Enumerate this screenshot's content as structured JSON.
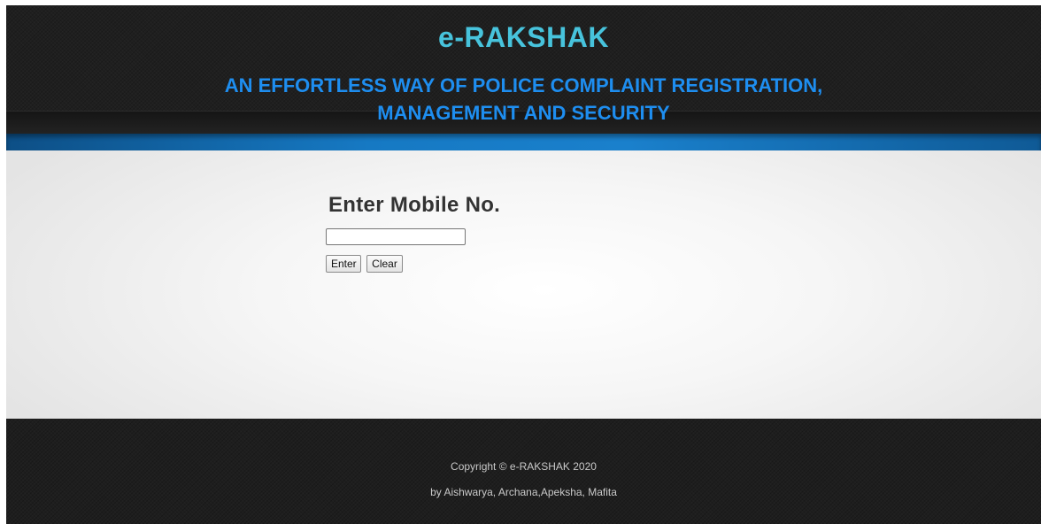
{
  "header": {
    "title": "e-RAKSHAK",
    "tagline_line1": "AN EFFORTLESS WAY OF POLICE COMPLAINT REGISTRATION,",
    "tagline_line2": "MANAGEMENT AND SECURITY"
  },
  "form": {
    "heading": "Enter Mobile No.",
    "mobile_value": "",
    "enter_label": "Enter",
    "clear_label": "Clear"
  },
  "footer": {
    "copyright": "Copyright © e-RAKSHAK 2020",
    "credits": "by Aishwarya, Archana,Apeksha, Mafita"
  },
  "colors": {
    "title": "#47c3dc",
    "tagline": "#1e8ef0",
    "accent_bar": "#1679c3",
    "header_bg": "#1f1f1f",
    "footer_bg": "#1e1e1e"
  }
}
